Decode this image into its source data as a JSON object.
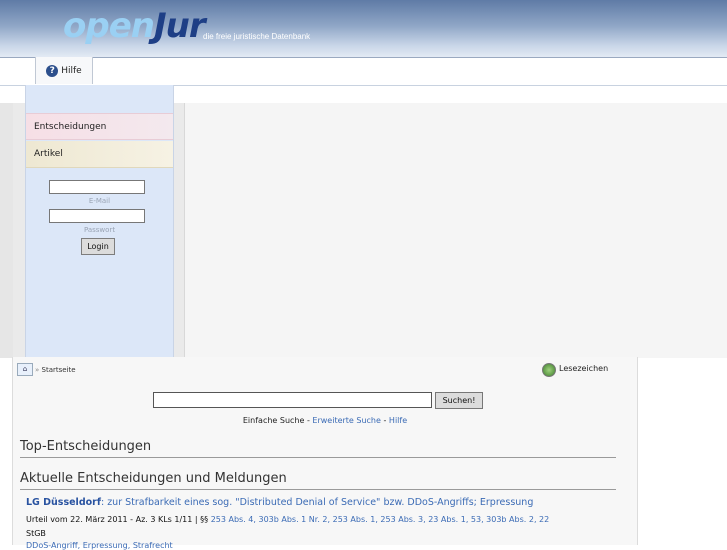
{
  "header": {
    "logo_open": "open",
    "logo_jur": "Jur",
    "tagline": "die freie juristische Datenbank"
  },
  "menu": {
    "hilfe": "Hilfe"
  },
  "sidebar": {
    "items": [
      {
        "label": "Entscheidungen"
      },
      {
        "label": "Artikel"
      }
    ],
    "email_label": "E-Mail",
    "password_label": "Passwort",
    "login_button": "Login"
  },
  "breadcrumb": {
    "separator": "»",
    "home": "Startseite"
  },
  "bookmark": "Lesezeichen",
  "search": {
    "button": "Suchen!",
    "simple": "Einfache Suche",
    "advanced": "Erweiterte Suche",
    "help": "Hilfe",
    "dash": " - "
  },
  "sections": {
    "top": "Top-Entscheidungen",
    "current": "Aktuelle Entscheidungen und Meldungen"
  },
  "entry": {
    "court": "LG Düsseldorf",
    "title_rest": ": zur Strafbarkeit eines sog. \"Distributed Denial of Service\" bzw. DDoS-Angriffs; Erpressung",
    "meta_prefix": "Urteil vom 22. März 2011 - Az. 3 KLs 1/11 | §§ ",
    "meta_links": "253 Abs. 4, 303b Abs. 1 Nr. 2, 253 Abs. 1, 253 Abs. 3, 23 Abs. 1, 53, 303b Abs. 2, 22",
    "meta_suffix": "StGB",
    "cut_line": "DDoS-Angriff, Erpressung, Strafrecht"
  },
  "colors": {
    "header_dark": "#5f7ba6",
    "logo_dark": "#1e3f86",
    "logo_light": "#9ad0f3",
    "link": "#3b6bb5",
    "sidebar_bg": "#dce7f8"
  }
}
